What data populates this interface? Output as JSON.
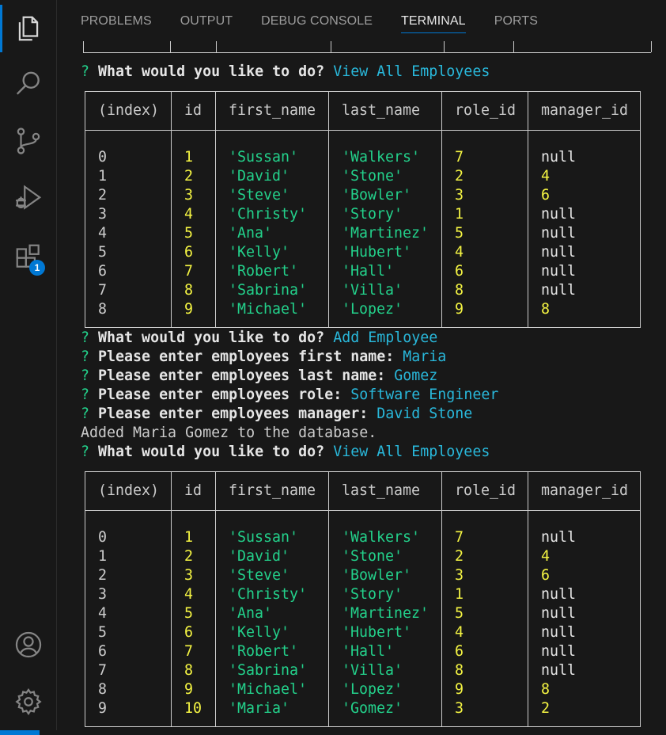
{
  "activity_bar": {
    "items": [
      {
        "name": "explorer",
        "icon": "files-icon",
        "active": true
      },
      {
        "name": "search",
        "icon": "search-icon"
      },
      {
        "name": "source-control",
        "icon": "source-control-icon"
      },
      {
        "name": "run-debug",
        "icon": "run-debug-icon"
      },
      {
        "name": "extensions",
        "icon": "extensions-icon",
        "badge": "1"
      }
    ],
    "bottom_items": [
      {
        "name": "accounts",
        "icon": "account-icon"
      },
      {
        "name": "manage",
        "icon": "gear-icon"
      }
    ],
    "accent_color": "#0078d4"
  },
  "panel": {
    "tabs": [
      {
        "label": "PROBLEMS"
      },
      {
        "label": "OUTPUT"
      },
      {
        "label": "DEBUG CONSOLE"
      },
      {
        "label": "TERMINAL",
        "active": true
      },
      {
        "label": "PORTS"
      }
    ]
  },
  "terminal": {
    "q_mark": "?",
    "block1": {
      "prompt": "What would you like to do?",
      "answer": "View All Employees"
    },
    "table1": {
      "headers": [
        "(index)",
        "id",
        "first_name",
        "last_name",
        "role_id",
        "manager_id"
      ],
      "rows": [
        [
          "0",
          "1",
          "'Sussan'",
          "'Walkers'",
          "7",
          "null"
        ],
        [
          "1",
          "2",
          "'David'",
          "'Stone'",
          "2",
          "4"
        ],
        [
          "2",
          "3",
          "'Steve'",
          "'Bowler'",
          "3",
          "6"
        ],
        [
          "3",
          "4",
          "'Christy'",
          "'Story'",
          "1",
          "null"
        ],
        [
          "4",
          "5",
          "'Ana'",
          "'Martinez'",
          "5",
          "null"
        ],
        [
          "5",
          "6",
          "'Kelly'",
          "'Hubert'",
          "4",
          "null"
        ],
        [
          "6",
          "7",
          "'Robert'",
          "'Hall'",
          "6",
          "null"
        ],
        [
          "7",
          "8",
          "'Sabrina'",
          "'Villa'",
          "8",
          "null"
        ],
        [
          "8",
          "9",
          "'Michael'",
          "'Lopez'",
          "9",
          "8"
        ]
      ]
    },
    "add_block": [
      {
        "prompt": "What would you like to do?",
        "answer": "Add Employee"
      },
      {
        "prompt": "Please enter employees first name:",
        "answer": "Maria"
      },
      {
        "prompt": "Please enter employees last name:",
        "answer": "Gomez"
      },
      {
        "prompt": "Please enter employees role:",
        "answer": "Software Engineer"
      },
      {
        "prompt": "Please enter employees manager:",
        "answer": "David Stone"
      }
    ],
    "confirmation": "Added Maria Gomez to the database.",
    "block2": {
      "prompt": "What would you like to do?",
      "answer": "View All Employees"
    },
    "table2": {
      "headers": [
        "(index)",
        "id",
        "first_name",
        "last_name",
        "role_id",
        "manager_id"
      ],
      "rows": [
        [
          "0",
          "1",
          "'Sussan'",
          "'Walkers'",
          "7",
          "null"
        ],
        [
          "1",
          "2",
          "'David'",
          "'Stone'",
          "2",
          "4"
        ],
        [
          "2",
          "3",
          "'Steve'",
          "'Bowler'",
          "3",
          "6"
        ],
        [
          "3",
          "4",
          "'Christy'",
          "'Story'",
          "1",
          "null"
        ],
        [
          "4",
          "5",
          "'Ana'",
          "'Martinez'",
          "5",
          "null"
        ],
        [
          "5",
          "6",
          "'Kelly'",
          "'Hubert'",
          "4",
          "null"
        ],
        [
          "6",
          "7",
          "'Robert'",
          "'Hall'",
          "6",
          "null"
        ],
        [
          "7",
          "8",
          "'Sabrina'",
          "'Villa'",
          "8",
          "null"
        ],
        [
          "8",
          "9",
          "'Michael'",
          "'Lopez'",
          "9",
          "8"
        ],
        [
          "9",
          "10",
          "'Maria'",
          "'Gomez'",
          "3",
          "2"
        ]
      ]
    }
  }
}
